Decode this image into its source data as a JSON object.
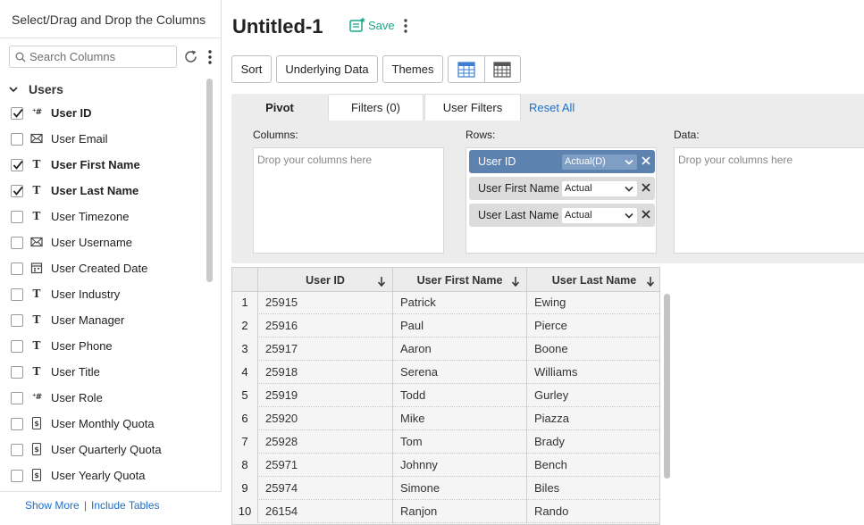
{
  "left_panel": {
    "title": "Select/Drag and Drop the Columns",
    "search_placeholder": "Search Columns",
    "group_label": "Users",
    "columns": [
      {
        "label": "User ID",
        "type": "number",
        "checked": true
      },
      {
        "label": "User Email",
        "type": "email",
        "checked": false
      },
      {
        "label": "User First Name",
        "type": "text",
        "checked": true
      },
      {
        "label": "User Last Name",
        "type": "text",
        "checked": true
      },
      {
        "label": "User Timezone",
        "type": "text",
        "checked": false
      },
      {
        "label": "User Username",
        "type": "email",
        "checked": false
      },
      {
        "label": "User Created Date",
        "type": "date",
        "checked": false
      },
      {
        "label": "User Industry",
        "type": "text",
        "checked": false
      },
      {
        "label": "User Manager",
        "type": "text",
        "checked": false
      },
      {
        "label": "User Phone",
        "type": "text",
        "checked": false
      },
      {
        "label": "User Title",
        "type": "text",
        "checked": false
      },
      {
        "label": "User Role",
        "type": "number",
        "checked": false
      },
      {
        "label": "User Monthly Quota",
        "type": "currency",
        "checked": false
      },
      {
        "label": "User Quarterly Quota",
        "type": "currency",
        "checked": false
      },
      {
        "label": "User Yearly Quota",
        "type": "currency",
        "checked": false
      }
    ],
    "footer": {
      "show_more": "Show More",
      "separator": "|",
      "include_tables": "Include Tables"
    }
  },
  "header": {
    "title": "Untitled-1",
    "save_label": "Save"
  },
  "toolbar": {
    "sort": "Sort",
    "underlying_data": "Underlying Data",
    "themes": "Themes"
  },
  "tabs": {
    "pivot": "Pivot",
    "filters": "Filters  (0)",
    "user_filters": "User Filters",
    "reset_all": "Reset All"
  },
  "zones": {
    "columns_label": "Columns:",
    "rows_label": "Rows:",
    "data_label": "Data:",
    "placeholder": "Drop your columns here",
    "rows": [
      {
        "label": "User ID",
        "agg": "Actual(D)",
        "active": true
      },
      {
        "label": "User First Name",
        "agg": "Actual",
        "active": false
      },
      {
        "label": "User Last Name",
        "agg": "Actual",
        "active": false
      }
    ]
  },
  "table": {
    "headers": [
      "User ID",
      "User First Name",
      "User Last Name"
    ],
    "rows": [
      {
        "n": "1",
        "id": "25915",
        "first": "Patrick",
        "last": "Ewing"
      },
      {
        "n": "2",
        "id": "25916",
        "first": "Paul",
        "last": "Pierce"
      },
      {
        "n": "3",
        "id": "25917",
        "first": "Aaron",
        "last": "Boone"
      },
      {
        "n": "4",
        "id": "25918",
        "first": "Serena",
        "last": "Williams"
      },
      {
        "n": "5",
        "id": "25919",
        "first": "Todd",
        "last": "Gurley"
      },
      {
        "n": "6",
        "id": "25920",
        "first": "Mike",
        "last": "Piazza"
      },
      {
        "n": "7",
        "id": "25928",
        "first": "Tom",
        "last": "Brady"
      },
      {
        "n": "8",
        "id": "25971",
        "first": "Johnny",
        "last": "Bench"
      },
      {
        "n": "9",
        "id": "25974",
        "first": "Simone",
        "last": "Biles"
      },
      {
        "n": "10",
        "id": "26154",
        "first": "Ranjon",
        "last": "Rando"
      }
    ]
  },
  "colors": {
    "accent_blue": "#1e6fc9",
    "save_green": "#18a889",
    "active_chip": "#5d82b0"
  }
}
